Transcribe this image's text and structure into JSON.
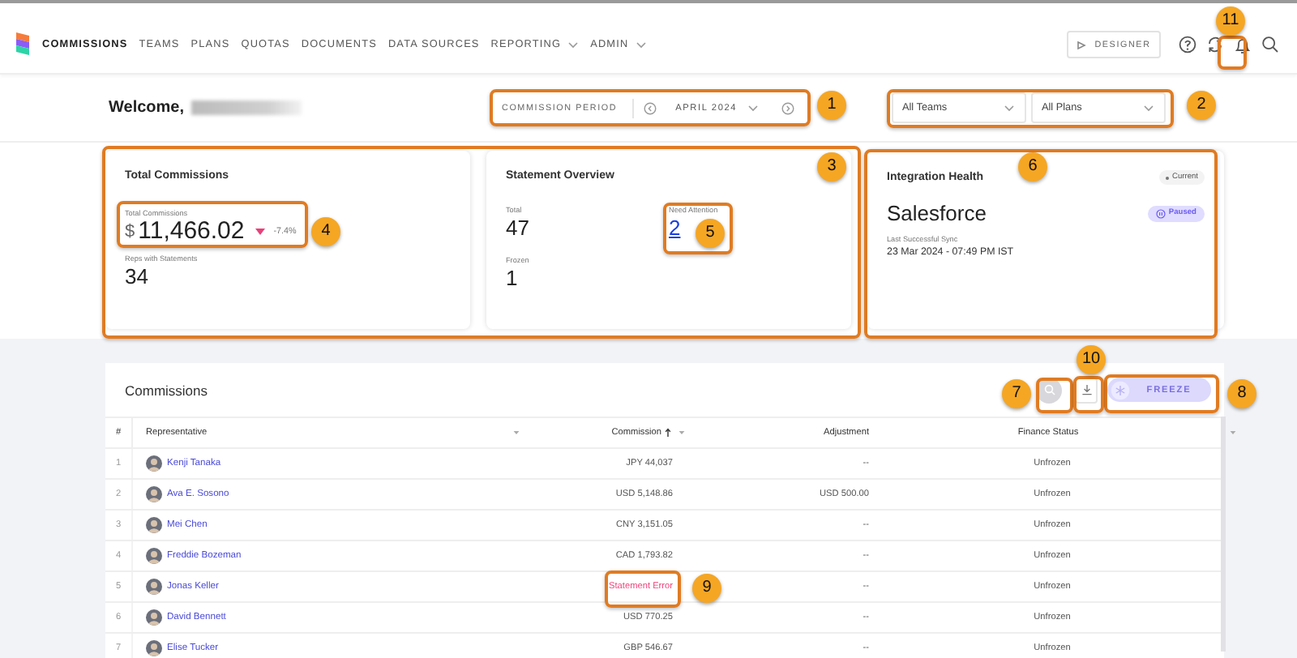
{
  "nav": {
    "items": [
      {
        "label": "COMMISSIONS",
        "selected": true,
        "dropdown": false
      },
      {
        "label": "TEAMS",
        "selected": false,
        "dropdown": false
      },
      {
        "label": "PLANS",
        "selected": false,
        "dropdown": false
      },
      {
        "label": "QUOTAS",
        "selected": false,
        "dropdown": false
      },
      {
        "label": "DOCUMENTS",
        "selected": false,
        "dropdown": false
      },
      {
        "label": "DATA SOURCES",
        "selected": false,
        "dropdown": false
      },
      {
        "label": "REPORTING",
        "selected": false,
        "dropdown": true
      },
      {
        "label": "ADMIN",
        "selected": false,
        "dropdown": true
      }
    ],
    "designer_button": "DESIGNER"
  },
  "welcome": {
    "greeting": "Welcome,"
  },
  "period": {
    "label": "COMMISSION PERIOD",
    "value": "APRIL 2024"
  },
  "filters": [
    {
      "value": "All Teams"
    },
    {
      "value": "All Plans"
    }
  ],
  "total_commissions": {
    "title": "Total Commissions",
    "label": "Total Commissions",
    "currency": "$",
    "amount": "11,466.02",
    "change_negative": true,
    "change": "-7.4%",
    "reps_label": "Reps with Statements",
    "reps": "34"
  },
  "statement_overview": {
    "title": "Statement Overview",
    "stats": [
      {
        "label": "Total",
        "value": "47",
        "link": false
      },
      {
        "label": "Need Attention",
        "value": "2",
        "link": true
      },
      {
        "label": "Frozen",
        "value": "1",
        "link": false
      }
    ]
  },
  "integration_health": {
    "title": "Integration Health",
    "tag": "Current",
    "system": "Salesforce",
    "status": "Paused",
    "sync_label": "Last Successful Sync",
    "sync_time": "23 Mar 2024 - 07:49 PM IST"
  },
  "commissions": {
    "title": "Commissions",
    "freeze_button": {
      "label": "FREEZE",
      "disabled": true
    },
    "columns": [
      {
        "label": "#",
        "sorted": false,
        "filter": false
      },
      {
        "label": "Representative",
        "sorted": false,
        "filter": true
      },
      {
        "label": "Commission",
        "sorted": true,
        "filter": true
      },
      {
        "label": "Adjustment",
        "sorted": false,
        "filter": false
      },
      {
        "label": "Finance Status",
        "sorted": false,
        "filter": true
      }
    ],
    "rows": [
      {
        "index": "1",
        "name": "Kenji Tanaka",
        "commission": "JPY 44,037",
        "error": false,
        "adjustment": "--",
        "status": "Unfrozen"
      },
      {
        "index": "2",
        "name": "Ava E. Sosono",
        "commission": "USD 5,148.86",
        "error": false,
        "adjustment": "USD 500.00",
        "status": "Unfrozen"
      },
      {
        "index": "3",
        "name": "Mei Chen",
        "commission": "CNY 3,151.05",
        "error": false,
        "adjustment": "--",
        "status": "Unfrozen"
      },
      {
        "index": "4",
        "name": "Freddie Bozeman",
        "commission": "CAD 1,793.82",
        "error": false,
        "adjustment": "--",
        "status": "Unfrozen"
      },
      {
        "index": "5",
        "name": "Jonas Keller",
        "commission": "Statement Error",
        "error": true,
        "adjustment": "--",
        "status": "Unfrozen"
      },
      {
        "index": "6",
        "name": "David Bennett",
        "commission": "USD 770.25",
        "error": false,
        "adjustment": "--",
        "status": "Unfrozen"
      },
      {
        "index": "7",
        "name": "Elise Tucker",
        "commission": "GBP 546.67",
        "error": false,
        "adjustment": "--",
        "status": "Unfrozen"
      }
    ]
  },
  "callouts": [
    {
      "number": "1"
    },
    {
      "number": "2"
    },
    {
      "number": "3"
    },
    {
      "number": "4"
    },
    {
      "number": "5"
    },
    {
      "number": "6"
    },
    {
      "number": "7"
    },
    {
      "number": "8"
    },
    {
      "number": "9"
    },
    {
      "number": "10"
    },
    {
      "number": "11"
    }
  ]
}
